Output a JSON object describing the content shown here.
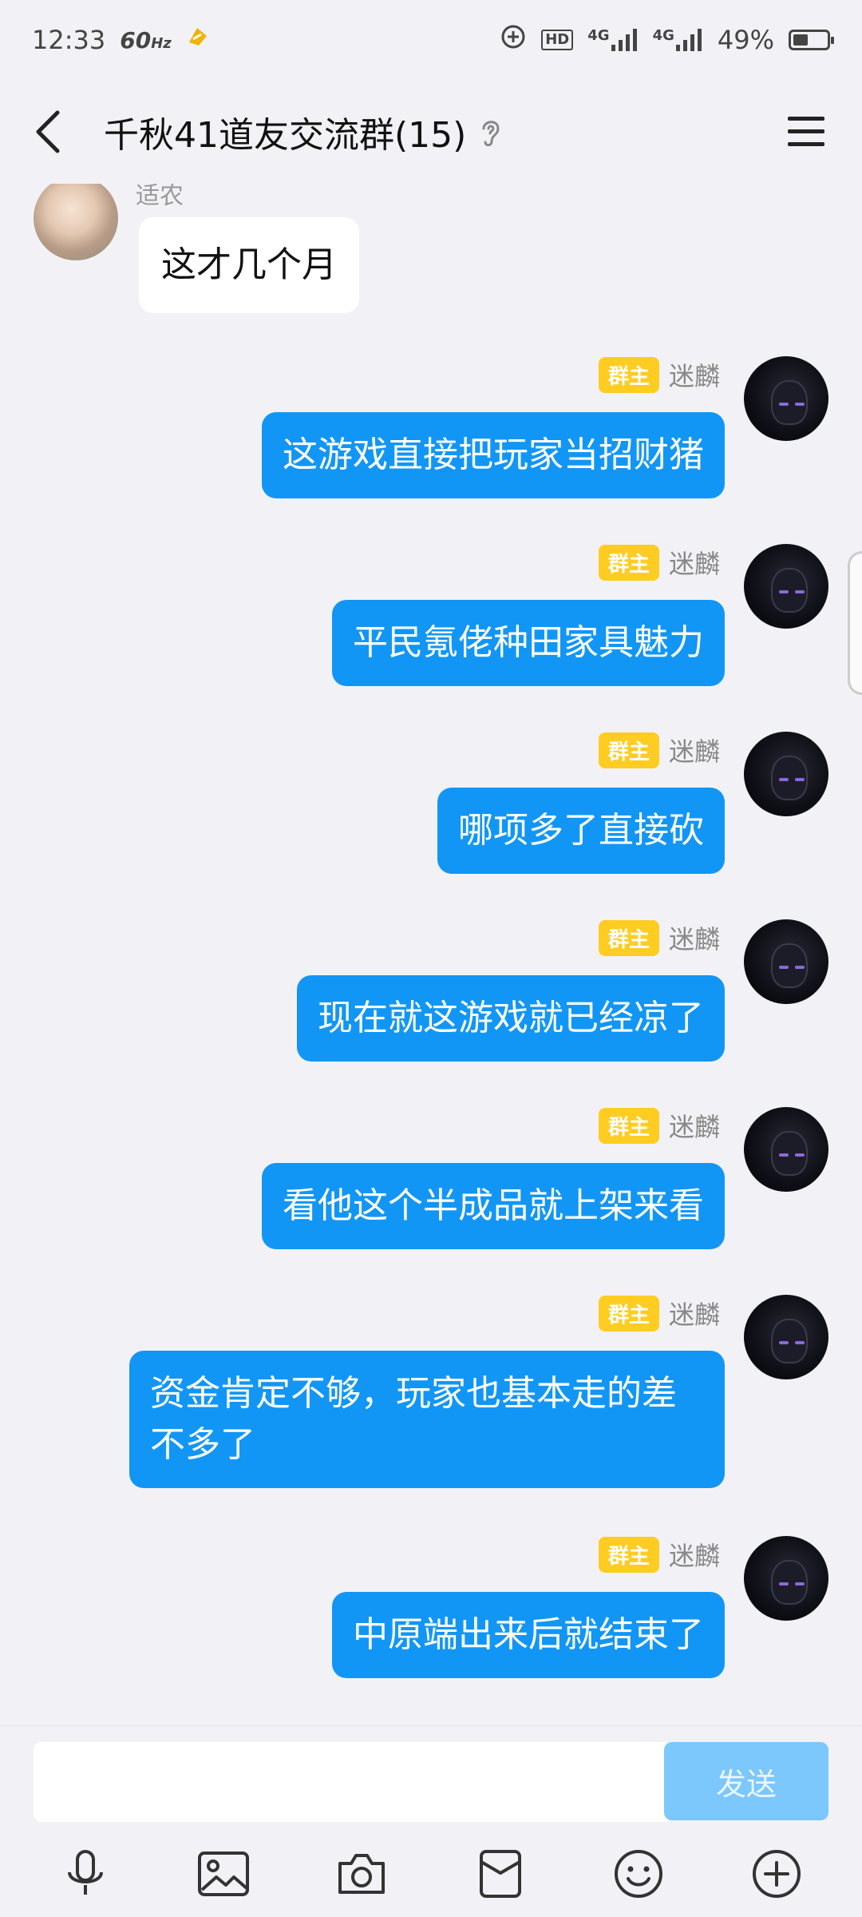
{
  "status_bar": {
    "time": "12:33",
    "refresh_rate": "60",
    "refresh_unit": "Hz",
    "hd_label": "HD",
    "network_1": "4G",
    "network_2": "4G",
    "battery_percent": "49%"
  },
  "header": {
    "title": "千秋41道友交流群(15)"
  },
  "messages": [
    {
      "side": "left",
      "sender": "适农",
      "text": "这才几个月"
    },
    {
      "side": "right",
      "badge": "群主",
      "sender": "迷麟",
      "text": "这游戏直接把玩家当招财猪"
    },
    {
      "side": "right",
      "badge": "群主",
      "sender": "迷麟",
      "text": "平民氪佬种田家具魅力"
    },
    {
      "side": "right",
      "badge": "群主",
      "sender": "迷麟",
      "text": "哪项多了直接砍"
    },
    {
      "side": "right",
      "badge": "群主",
      "sender": "迷麟",
      "text": "现在就这游戏就已经凉了"
    },
    {
      "side": "right",
      "badge": "群主",
      "sender": "迷麟",
      "text": "看他这个半成品就上架来看"
    },
    {
      "side": "right",
      "badge": "群主",
      "sender": "迷麟",
      "text": "资金肯定不够，玩家也基本走的差不多了"
    },
    {
      "side": "right",
      "badge": "群主",
      "sender": "迷麟",
      "text": "中原端出来后就结束了"
    }
  ],
  "input": {
    "value": "",
    "placeholder": "",
    "send_label": "发送"
  },
  "colors": {
    "bubble_self": "#1296f5",
    "badge_owner": "#ffcc22",
    "send_disabled": "#7cc7fb"
  },
  "toolbar_icons": [
    "microphone-icon",
    "image-icon",
    "camera-icon",
    "red-packet-icon",
    "emoji-icon",
    "plus-icon"
  ]
}
